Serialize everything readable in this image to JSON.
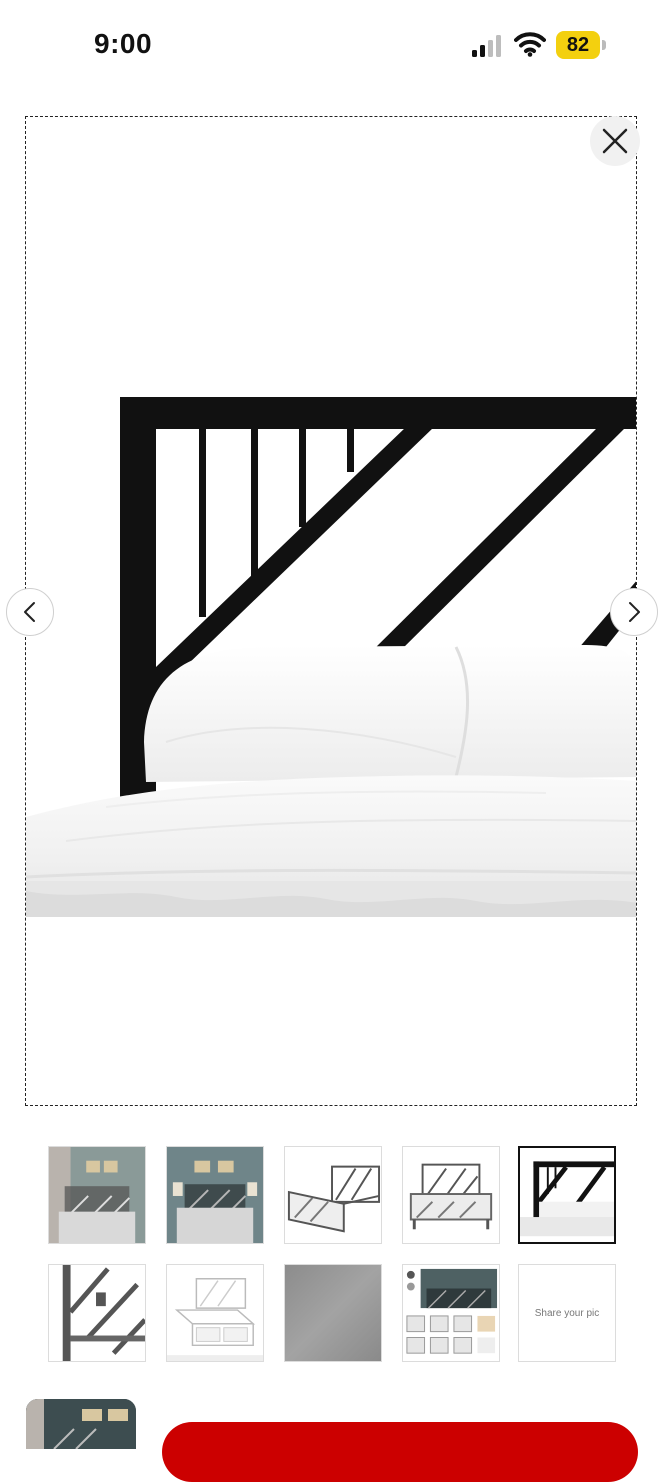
{
  "status_bar": {
    "time": "9:00",
    "battery_level": "82",
    "icons": [
      "signal-icon",
      "wifi-icon",
      "battery-icon"
    ],
    "battery_color": "#f3d00f"
  },
  "viewer": {
    "image": "metal-bed-headboard-closeup",
    "controls": [
      "close-icon",
      "chevron-left-icon",
      "chevron-right-icon"
    ]
  },
  "thumbnails": [
    {
      "image": "bed-room-photo-1"
    },
    {
      "image": "bed-room-photo-2"
    },
    {
      "image": "bed-angle-view"
    },
    {
      "image": "bed-front-view"
    },
    {
      "image": "headboard-closeup",
      "selected": true
    },
    {
      "image": "frame-corner-detail"
    },
    {
      "image": "bed-frame-storage-sketch"
    },
    {
      "image": "gray-swatch"
    },
    {
      "image": "feature-collage"
    },
    {
      "label": "Share your pic"
    }
  ],
  "bottom": {
    "cta_color": "#cc0000"
  }
}
